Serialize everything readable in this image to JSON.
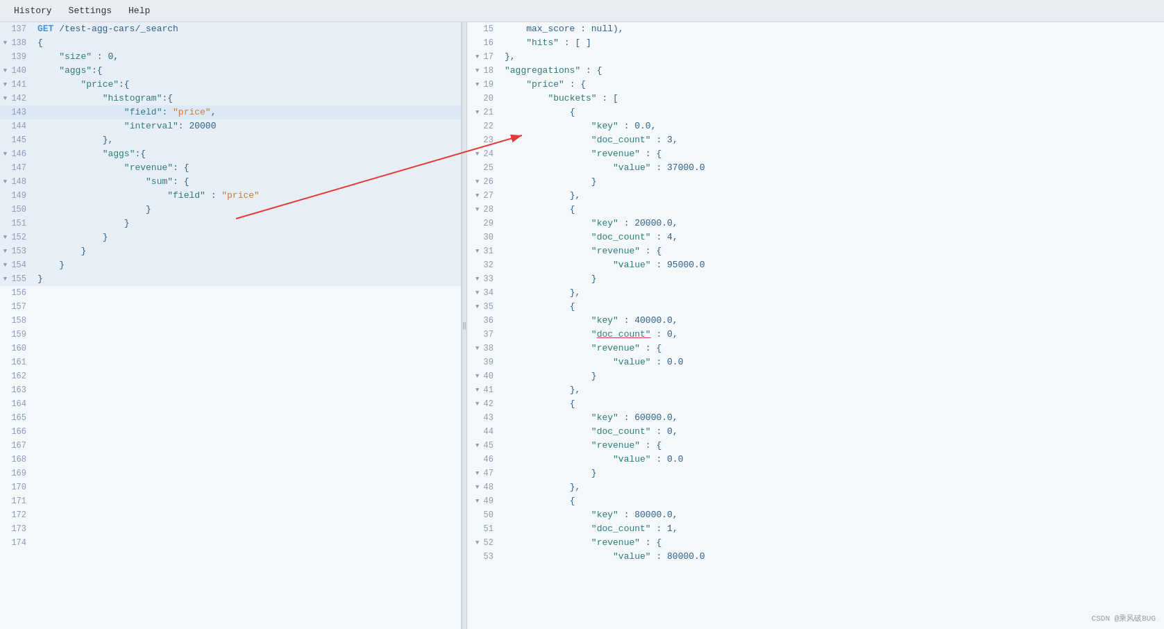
{
  "menubar": {
    "items": [
      "History",
      "Settings",
      "Help"
    ]
  },
  "left_panel": {
    "lines": [
      {
        "num": "137",
        "content": "GET /test-agg-cars/_search",
        "type": "url",
        "fold": false,
        "highlight": true
      },
      {
        "num": "138",
        "content": "{",
        "type": "bracket",
        "fold": true,
        "highlight": true
      },
      {
        "num": "139",
        "content": "    \"size\" : 0,",
        "type": "code",
        "fold": false,
        "highlight": true
      },
      {
        "num": "140",
        "content": "    \"aggs\":{",
        "type": "code",
        "fold": true,
        "highlight": true
      },
      {
        "num": "141",
        "content": "        \"price\":{",
        "type": "code",
        "fold": true,
        "highlight": true
      },
      {
        "num": "142",
        "content": "            \"histogram\":{",
        "type": "code",
        "fold": true,
        "highlight": true
      },
      {
        "num": "143",
        "content": "                \"field\": \"price\",",
        "type": "selected",
        "fold": false,
        "highlight": true
      },
      {
        "num": "144",
        "content": "                \"interval\": 20000",
        "type": "code",
        "fold": false,
        "highlight": true
      },
      {
        "num": "145",
        "content": "            },",
        "type": "code",
        "fold": false,
        "highlight": true
      },
      {
        "num": "146",
        "content": "            \"aggs\":{",
        "type": "code",
        "fold": true,
        "highlight": true
      },
      {
        "num": "147",
        "content": "                \"revenue\": {",
        "type": "code",
        "fold": false,
        "highlight": true
      },
      {
        "num": "148",
        "content": "                    \"sum\": {",
        "type": "code",
        "fold": true,
        "highlight": true
      },
      {
        "num": "149",
        "content": "                        \"field\" : \"price\"",
        "type": "code",
        "fold": false,
        "highlight": true
      },
      {
        "num": "150",
        "content": "                    }",
        "type": "code",
        "fold": false,
        "highlight": true
      },
      {
        "num": "151",
        "content": "                }",
        "type": "code",
        "fold": false,
        "highlight": true
      },
      {
        "num": "152",
        "content": "            }",
        "type": "code",
        "fold": true,
        "highlight": true
      },
      {
        "num": "153",
        "content": "        }",
        "type": "code",
        "fold": true,
        "highlight": true
      },
      {
        "num": "154",
        "content": "    }",
        "type": "code",
        "fold": true,
        "highlight": true
      },
      {
        "num": "155",
        "content": "}",
        "type": "bracket",
        "fold": true,
        "highlight": true
      },
      {
        "num": "156",
        "content": "",
        "type": "empty",
        "fold": false,
        "highlight": false
      },
      {
        "num": "157",
        "content": "",
        "type": "empty",
        "fold": false,
        "highlight": false
      },
      {
        "num": "158",
        "content": "",
        "type": "empty",
        "fold": false,
        "highlight": false
      },
      {
        "num": "159",
        "content": "",
        "type": "empty",
        "fold": false,
        "highlight": false
      },
      {
        "num": "160",
        "content": "",
        "type": "empty",
        "fold": false,
        "highlight": false
      },
      {
        "num": "161",
        "content": "",
        "type": "empty",
        "fold": false,
        "highlight": false
      },
      {
        "num": "162",
        "content": "",
        "type": "empty",
        "fold": false,
        "highlight": false
      },
      {
        "num": "163",
        "content": "",
        "type": "empty",
        "fold": false,
        "highlight": false
      },
      {
        "num": "164",
        "content": "",
        "type": "empty",
        "fold": false,
        "highlight": false
      },
      {
        "num": "165",
        "content": "",
        "type": "empty",
        "fold": false,
        "highlight": false
      },
      {
        "num": "166",
        "content": "",
        "type": "empty",
        "fold": false,
        "highlight": false
      },
      {
        "num": "167",
        "content": "",
        "type": "empty",
        "fold": false,
        "highlight": false
      },
      {
        "num": "168",
        "content": "",
        "type": "empty",
        "fold": false,
        "highlight": false
      },
      {
        "num": "169",
        "content": "",
        "type": "empty",
        "fold": false,
        "highlight": false
      },
      {
        "num": "170",
        "content": "",
        "type": "empty",
        "fold": false,
        "highlight": false
      },
      {
        "num": "171",
        "content": "",
        "type": "empty",
        "fold": false,
        "highlight": false
      },
      {
        "num": "172",
        "content": "",
        "type": "empty",
        "fold": false,
        "highlight": false
      },
      {
        "num": "173",
        "content": "",
        "type": "empty",
        "fold": false,
        "highlight": false
      },
      {
        "num": "174",
        "content": "",
        "type": "empty",
        "fold": false,
        "highlight": false
      }
    ]
  },
  "right_panel": {
    "lines": [
      {
        "num": "15",
        "content": "    max_score : null),",
        "fold": false
      },
      {
        "num": "16",
        "content": "    \"hits\" : [ ]",
        "fold": false
      },
      {
        "num": "17",
        "content": "},",
        "fold": true
      },
      {
        "num": "18",
        "content": "\"aggregations\" : {",
        "fold": true
      },
      {
        "num": "19",
        "content": "    \"price\" : {",
        "fold": true
      },
      {
        "num": "20",
        "content": "        \"buckets\" : [",
        "fold": false
      },
      {
        "num": "21",
        "content": "            {",
        "fold": true
      },
      {
        "num": "22",
        "content": "                \"key\" : 0.0,",
        "fold": false
      },
      {
        "num": "23",
        "content": "                \"doc_count\" : 3,",
        "fold": false
      },
      {
        "num": "24",
        "content": "                \"revenue\" : {",
        "fold": true
      },
      {
        "num": "25",
        "content": "                    \"value\" : 37000.0",
        "fold": false
      },
      {
        "num": "26",
        "content": "                }",
        "fold": true
      },
      {
        "num": "27",
        "content": "            },",
        "fold": true
      },
      {
        "num": "28",
        "content": "            {",
        "fold": true
      },
      {
        "num": "29",
        "content": "                \"key\" : 20000.0,",
        "fold": false
      },
      {
        "num": "30",
        "content": "                \"doc_count\" : 4,",
        "fold": false
      },
      {
        "num": "31",
        "content": "                \"revenue\" : {",
        "fold": true
      },
      {
        "num": "32",
        "content": "                    \"value\" : 95000.0",
        "fold": false
      },
      {
        "num": "33",
        "content": "                }",
        "fold": true
      },
      {
        "num": "34",
        "content": "            },",
        "fold": true
      },
      {
        "num": "35",
        "content": "            {",
        "fold": true
      },
      {
        "num": "36",
        "content": "                \"key\" : 40000.0,",
        "fold": false
      },
      {
        "num": "37",
        "content": "                \"doc_count\" : 0,",
        "fold": false,
        "underline": true
      },
      {
        "num": "38",
        "content": "                \"revenue\" : {",
        "fold": true
      },
      {
        "num": "39",
        "content": "                    \"value\" : 0.0",
        "fold": false
      },
      {
        "num": "40",
        "content": "                }",
        "fold": true
      },
      {
        "num": "41",
        "content": "            },",
        "fold": true
      },
      {
        "num": "42",
        "content": "            {",
        "fold": true
      },
      {
        "num": "43",
        "content": "                \"key\" : 60000.0,",
        "fold": false
      },
      {
        "num": "44",
        "content": "                \"doc_count\" : 0,",
        "fold": false
      },
      {
        "num": "45",
        "content": "                \"revenue\" : {",
        "fold": true
      },
      {
        "num": "46",
        "content": "                    \"value\" : 0.0",
        "fold": false
      },
      {
        "num": "47",
        "content": "                }",
        "fold": true
      },
      {
        "num": "48",
        "content": "            },",
        "fold": true
      },
      {
        "num": "49",
        "content": "            {",
        "fold": true
      },
      {
        "num": "50",
        "content": "                \"key\" : 80000.0,",
        "fold": false
      },
      {
        "num": "51",
        "content": "                \"doc_count\" : 1,",
        "fold": false
      },
      {
        "num": "52",
        "content": "                \"revenue\" : {",
        "fold": true
      },
      {
        "num": "53",
        "content": "                    \"value\" : 80000.0",
        "fold": false
      }
    ]
  },
  "watermark": "CSDN @乘风破BUG"
}
